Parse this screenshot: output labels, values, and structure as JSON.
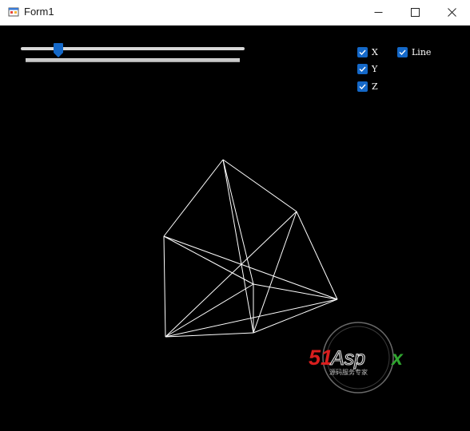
{
  "window": {
    "title": "Form1",
    "icons": {
      "app": "form-app-icon",
      "minimize": "minimize-icon",
      "maximize": "maximize-icon",
      "close": "close-icon"
    }
  },
  "slider": {
    "value_fraction": 0.17
  },
  "checkboxes": [
    {
      "key": "x",
      "label": "X",
      "checked": true
    },
    {
      "key": "y",
      "label": "Y",
      "checked": true
    },
    {
      "key": "z",
      "label": "Z",
      "checked": true
    },
    {
      "key": "line",
      "label": "Line",
      "checked": true
    }
  ],
  "watermark": {
    "brand": "51Aspx",
    "tagline": "源码服务专家"
  },
  "colors": {
    "background": "#000000",
    "wireframe": "#ffffff",
    "checkbox": "#1468c8",
    "slider_thumb": "#1468c8"
  }
}
